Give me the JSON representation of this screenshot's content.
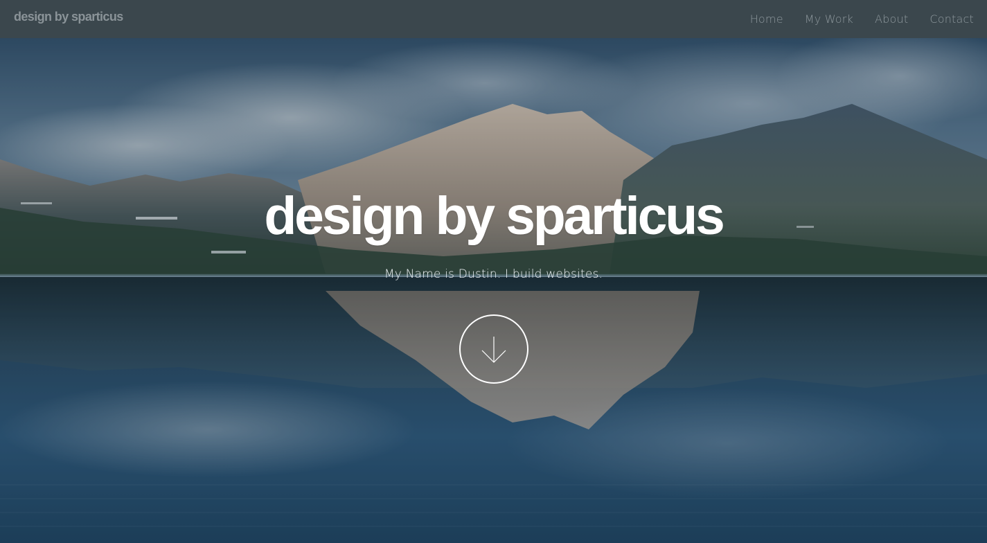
{
  "navbar": {
    "brand": "design by sparticus",
    "links": [
      {
        "label": "Home"
      },
      {
        "label": "My Work"
      },
      {
        "label": "About"
      },
      {
        "label": "Contact"
      }
    ]
  },
  "hero": {
    "title": "design by sparticus",
    "subtitle": "My Name is Dustin. I build websites.",
    "scroll_icon": "arrow-down-icon"
  },
  "colors": {
    "navbar_bg": "#3b474d",
    "nav_text": "#8e989d",
    "hero_text": "#ffffff"
  }
}
